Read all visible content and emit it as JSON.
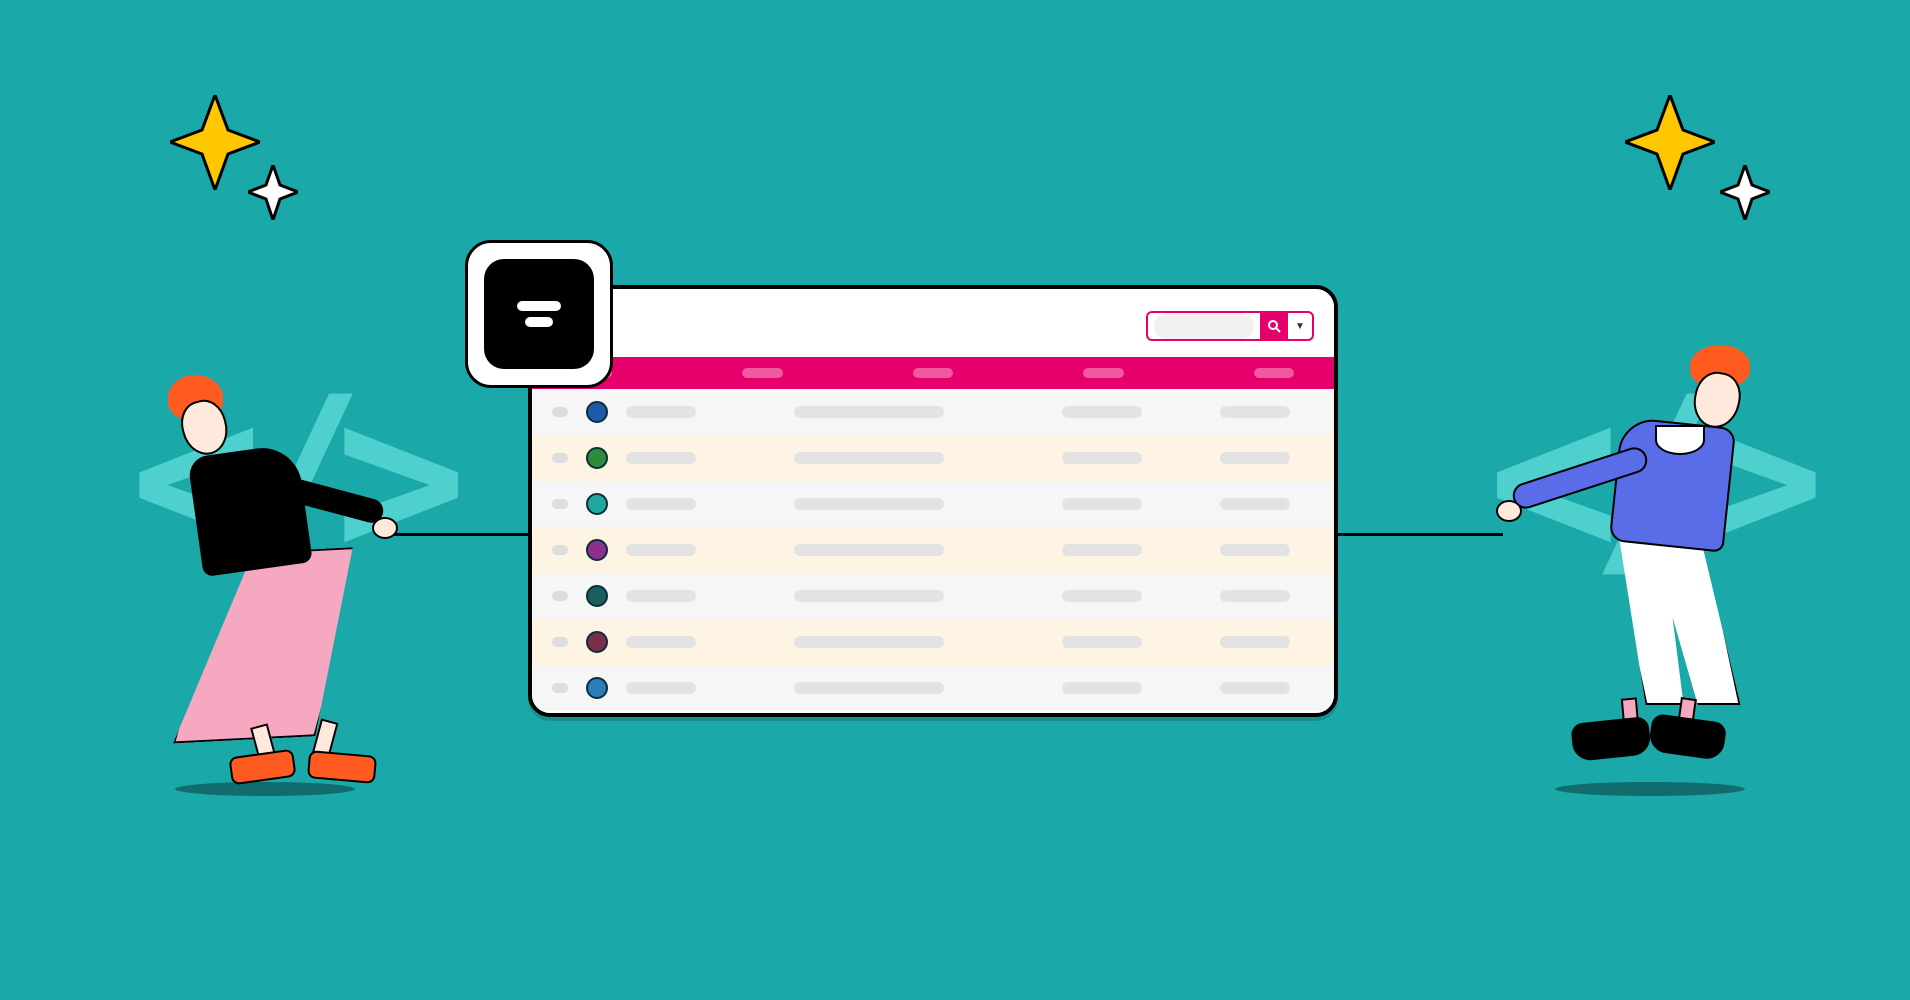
{
  "colors": {
    "bg": "#1ba8a8",
    "magenta": "#e6006b",
    "orange": "#ff5a1f",
    "blue": "#5a6de8",
    "pink": "#f5a8c0",
    "cream": "#fdf4e3",
    "yellow": "#ffc700"
  },
  "window": {
    "search_placeholder": "",
    "avatar_colors": [
      "#1e5aa8",
      "#2e8b3a",
      "#1fa8a0",
      "#8e2e8e",
      "#1a5f5f",
      "#7a2e4a",
      "#2a7fb8"
    ]
  }
}
